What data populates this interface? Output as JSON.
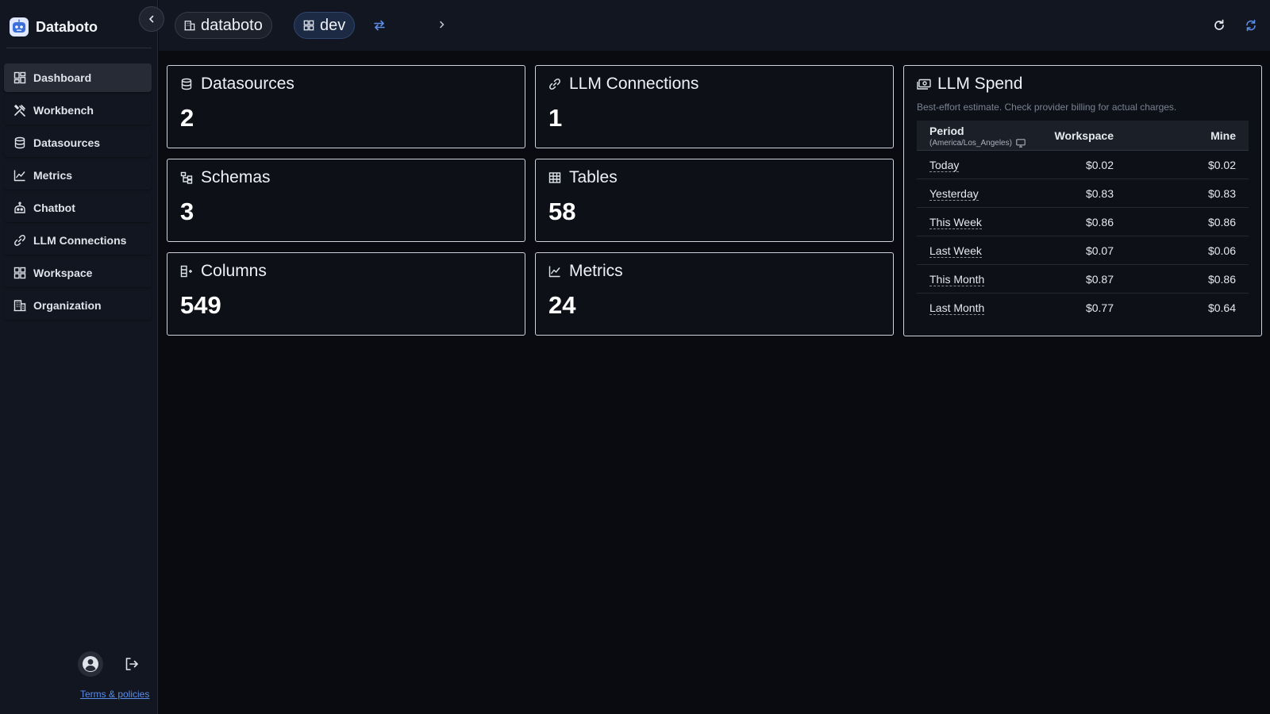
{
  "app": {
    "name": "Databoto"
  },
  "sidebar": {
    "items": [
      {
        "label": "Dashboard",
        "icon": "dashboard-icon",
        "active": true
      },
      {
        "label": "Workbench",
        "icon": "tools-icon"
      },
      {
        "label": "Datasources",
        "icon": "database-icon"
      },
      {
        "label": "Metrics",
        "icon": "line-chart-icon"
      },
      {
        "label": "Chatbot",
        "icon": "robot-icon"
      },
      {
        "label": "LLM Connections",
        "icon": "link-icon"
      },
      {
        "label": "Workspace",
        "icon": "grid-icon"
      },
      {
        "label": "Organization",
        "icon": "building-icon"
      }
    ],
    "terms_label": "Terms & policies"
  },
  "breadcrumb": {
    "org": "databoto",
    "workspace": "dev"
  },
  "cards": {
    "datasources": {
      "title": "Datasources",
      "value": "2"
    },
    "llm_connections": {
      "title": "LLM Connections",
      "value": "1"
    },
    "schemas": {
      "title": "Schemas",
      "value": "3"
    },
    "tables": {
      "title": "Tables",
      "value": "58"
    },
    "columns": {
      "title": "Columns",
      "value": "549"
    },
    "metrics": {
      "title": "Metrics",
      "value": "24"
    }
  },
  "spend": {
    "title": "LLM Spend",
    "note": "Best-effort estimate. Check provider billing for actual charges.",
    "columns": {
      "period": "Period",
      "timezone": "(America/Los_Angeles)",
      "workspace": "Workspace",
      "mine": "Mine"
    },
    "rows": [
      {
        "period": "Today",
        "workspace": "$0.02",
        "mine": "$0.02"
      },
      {
        "period": "Yesterday",
        "workspace": "$0.83",
        "mine": "$0.83"
      },
      {
        "period": "This Week",
        "workspace": "$0.86",
        "mine": "$0.86"
      },
      {
        "period": "Last Week",
        "workspace": "$0.07",
        "mine": "$0.06"
      },
      {
        "period": "This Month",
        "workspace": "$0.87",
        "mine": "$0.86"
      },
      {
        "period": "Last Month",
        "workspace": "$0.77",
        "mine": "$0.64"
      }
    ]
  },
  "colors": {
    "accent": "#5b8de8",
    "background": "#090b10",
    "sidebar": "#121620"
  }
}
